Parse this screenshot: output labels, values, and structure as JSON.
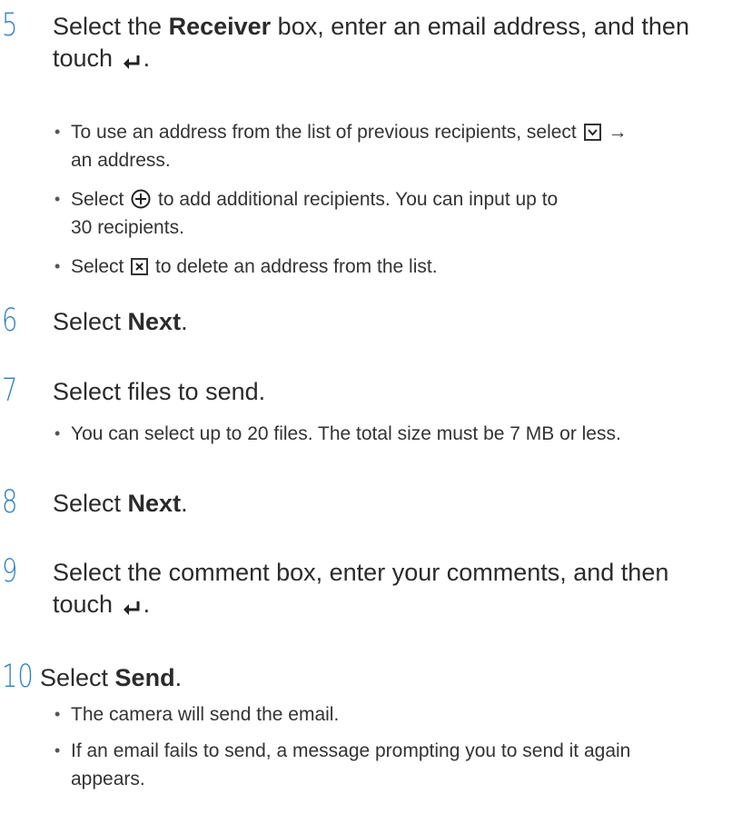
{
  "steps": [
    {
      "number": "5",
      "text_a": "Select the ",
      "bold": "Receiver",
      "text_b": " box, enter an email address, and then",
      "text_c": "touch ",
      "end_icon": "enter-return-icon",
      "text_d": ".",
      "bullets": [
        {
          "a": "To use an address from the list of previous recipients, select ",
          "icon": "dropdown-box-icon",
          "b": " →",
          "line2": "an address."
        },
        {
          "a": "Select ",
          "icon": "add-circle-icon",
          "b": " to add additional recipients. You can input up to",
          "line2": "30 recipients."
        },
        {
          "a": "Select ",
          "icon": "delete-box-icon",
          "b": " to delete an address from the list."
        }
      ]
    },
    {
      "number": "6",
      "text_a": "Select ",
      "bold": "Next",
      "text_b": "."
    },
    {
      "number": "7",
      "text_a": "Select files to send.",
      "bullets": [
        {
          "a": "You can select up to 20 files. The total size must be 7 MB or less."
        }
      ]
    },
    {
      "number": "8",
      "text_a": "Select ",
      "bold": "Next",
      "text_b": "."
    },
    {
      "number": "9",
      "text_a": "Select the comment box, enter your comments, and then",
      "text_c": "touch ",
      "end_icon": "enter-return-icon",
      "text_d": "."
    },
    {
      "number": "10",
      "text_a": "Select ",
      "bold": "Send",
      "text_b": ".",
      "bullets": [
        {
          "a": "The camera will send the email."
        },
        {
          "a": "If an email fails to send, a message prompting you to send it again",
          "line2": "appears."
        }
      ]
    }
  ],
  "colors": {
    "step_number": "#2f7fc1",
    "text": "#2b2b2b"
  }
}
